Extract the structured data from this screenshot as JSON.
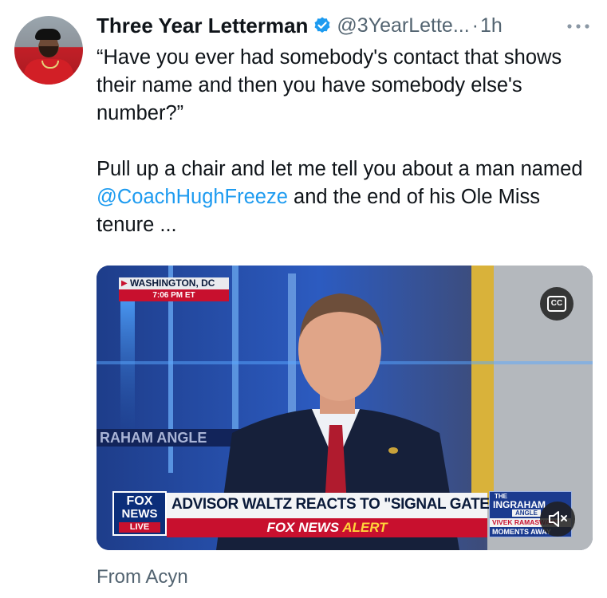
{
  "author": {
    "name": "Three Year Letterman",
    "handle": "@3YearLette...",
    "separator": "·",
    "time": "1h"
  },
  "tweet": {
    "line1": "“Have you ever had somebody's contact that shows their name and then you have somebody else's number?”",
    "line2_before": "Pull up a chair and let me tell you about a man named ",
    "mention": "@CoachHughFreeze",
    "line2_after": " and the end of his Ole Miss tenure ..."
  },
  "video": {
    "location": "WASHINGTON, DC",
    "clock": "7:06 PM ET",
    "side_banner": "RAHAM ANGLE",
    "logo_line1": "FOX",
    "logo_line2": "NEWS",
    "logo_live": "LIVE",
    "headline": "ADVISOR WALTZ REACTS TO \"SIGNAL GATE\"",
    "ticker_brand": "FOX NEWS",
    "ticker_alert": "ALERT",
    "show_the": "THE",
    "show_name": "INGRAHAM",
    "show_angle": "ANGLE",
    "promo_line1": "VIVEK RAMASWAMY",
    "promo_line2": "MOMENTS AWAY",
    "cc_label": "CC"
  },
  "source_label": "From Acyn",
  "colors": {
    "accent": "#1d9bf0",
    "secondary_text": "#536471",
    "fox_red": "#c8102e"
  },
  "icons": {
    "verified": "verified-badge-icon",
    "more": "more-dots-icon",
    "cc": "closed-captions-icon",
    "mute": "speaker-muted-icon"
  }
}
